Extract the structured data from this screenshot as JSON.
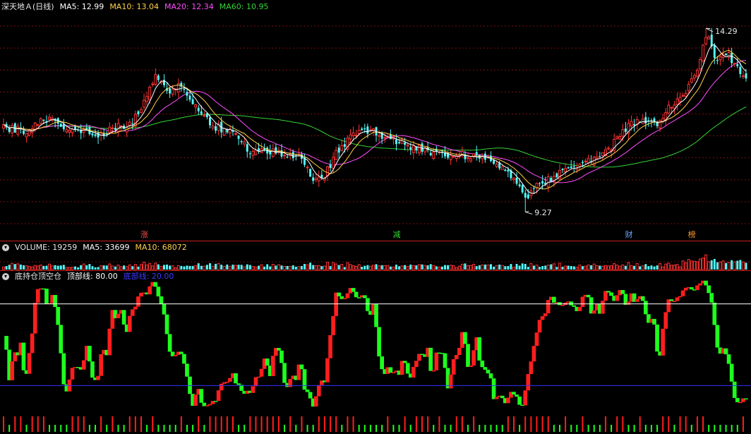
{
  "colors": {
    "up": "#ff3232",
    "down": "#54ffff",
    "ma5": "#ffffff",
    "ma10": "#ffd24a",
    "ma20": "#ff4dff",
    "ma60": "#35d435",
    "grid": "#7a1010",
    "divider": "#c81e1e",
    "osc_up": "#ff1e1e",
    "osc_down": "#1eff1e",
    "top_line": "#ffffff",
    "bottom_line": "#3232ff"
  },
  "main_header": {
    "title": "深天地Ａ(日线)",
    "ma5": "MA5: 12.99",
    "ma10": "MA10: 13.04",
    "ma20": "MA20: 12.34",
    "ma60": "MA60: 10.95"
  },
  "volume_header": {
    "title": "VOLUME: 19259",
    "ma5": "MA5: 33699",
    "ma10": "MA10: 68072"
  },
  "osc_header": {
    "title": "底持仓顶空仓",
    "top": "顶部线: 80.00",
    "bottom": "底部线: 20.00"
  },
  "markers": [
    {
      "text": "涨",
      "color": "#ff4d4d",
      "index": 49
    },
    {
      "text": "减",
      "color": "#33dd33",
      "index": 137
    },
    {
      "text": "财",
      "color": "#66aaff",
      "index": 218
    },
    {
      "text": "榜",
      "color": "#ff9a33",
      "index": 240
    }
  ],
  "annotations": {
    "high": "14.29",
    "low": "9.27"
  },
  "toggle_icon": "chevron-down-icon",
  "chart_data": {
    "type": "candlestick",
    "price_range": [
      8.7,
      14.6
    ],
    "gridlines": [
      14.35,
      13.75,
      13.15,
      12.55,
      11.95,
      11.35,
      10.75,
      10.15,
      9.55,
      8.95
    ],
    "high_point": {
      "index": 245,
      "value": 14.29
    },
    "low_point": {
      "index": 182,
      "value": 9.27
    },
    "ma_series": [
      {
        "name": "MA5",
        "period": 5
      },
      {
        "name": "MA10",
        "period": 10
      },
      {
        "name": "MA20",
        "period": 20
      },
      {
        "name": "MA60",
        "period": 60
      }
    ],
    "anchors": [
      [
        0,
        11.55
      ],
      [
        8,
        11.5
      ],
      [
        16,
        11.85
      ],
      [
        24,
        11.5
      ],
      [
        34,
        11.4
      ],
      [
        44,
        11.7
      ],
      [
        48,
        12.05
      ],
      [
        53,
        13.0
      ],
      [
        58,
        12.6
      ],
      [
        62,
        12.7
      ],
      [
        67,
        12.1
      ],
      [
        74,
        11.6
      ],
      [
        80,
        11.4
      ],
      [
        86,
        10.95
      ],
      [
        95,
        10.9
      ],
      [
        103,
        10.75
      ],
      [
        108,
        10.15
      ],
      [
        112,
        10.25
      ],
      [
        116,
        10.9
      ],
      [
        122,
        11.35
      ],
      [
        128,
        11.55
      ],
      [
        132,
        11.38
      ],
      [
        136,
        11.25
      ],
      [
        142,
        11.05
      ],
      [
        150,
        10.9
      ],
      [
        156,
        10.85
      ],
      [
        164,
        10.8
      ],
      [
        172,
        10.6
      ],
      [
        176,
        10.35
      ],
      [
        180,
        10.0
      ],
      [
        183,
        9.65
      ],
      [
        186,
        10.05
      ],
      [
        190,
        10.15
      ],
      [
        196,
        10.45
      ],
      [
        203,
        10.65
      ],
      [
        208,
        10.7
      ],
      [
        212,
        11.05
      ],
      [
        216,
        11.5
      ],
      [
        222,
        11.8
      ],
      [
        228,
        11.6
      ],
      [
        232,
        12.15
      ],
      [
        238,
        12.5
      ],
      [
        243,
        13.4
      ],
      [
        245,
        14.29
      ],
      [
        248,
        13.4
      ],
      [
        252,
        13.65
      ],
      [
        256,
        13.2
      ],
      [
        259,
        12.95
      ]
    ],
    "count": 260,
    "volume": {
      "max": 100000,
      "ma5": 33699,
      "ma10": 68072,
      "last": 19259
    },
    "oscillator": {
      "range": [
        0,
        100
      ],
      "top_line": 80,
      "bottom_line": 20,
      "length": 260
    }
  }
}
